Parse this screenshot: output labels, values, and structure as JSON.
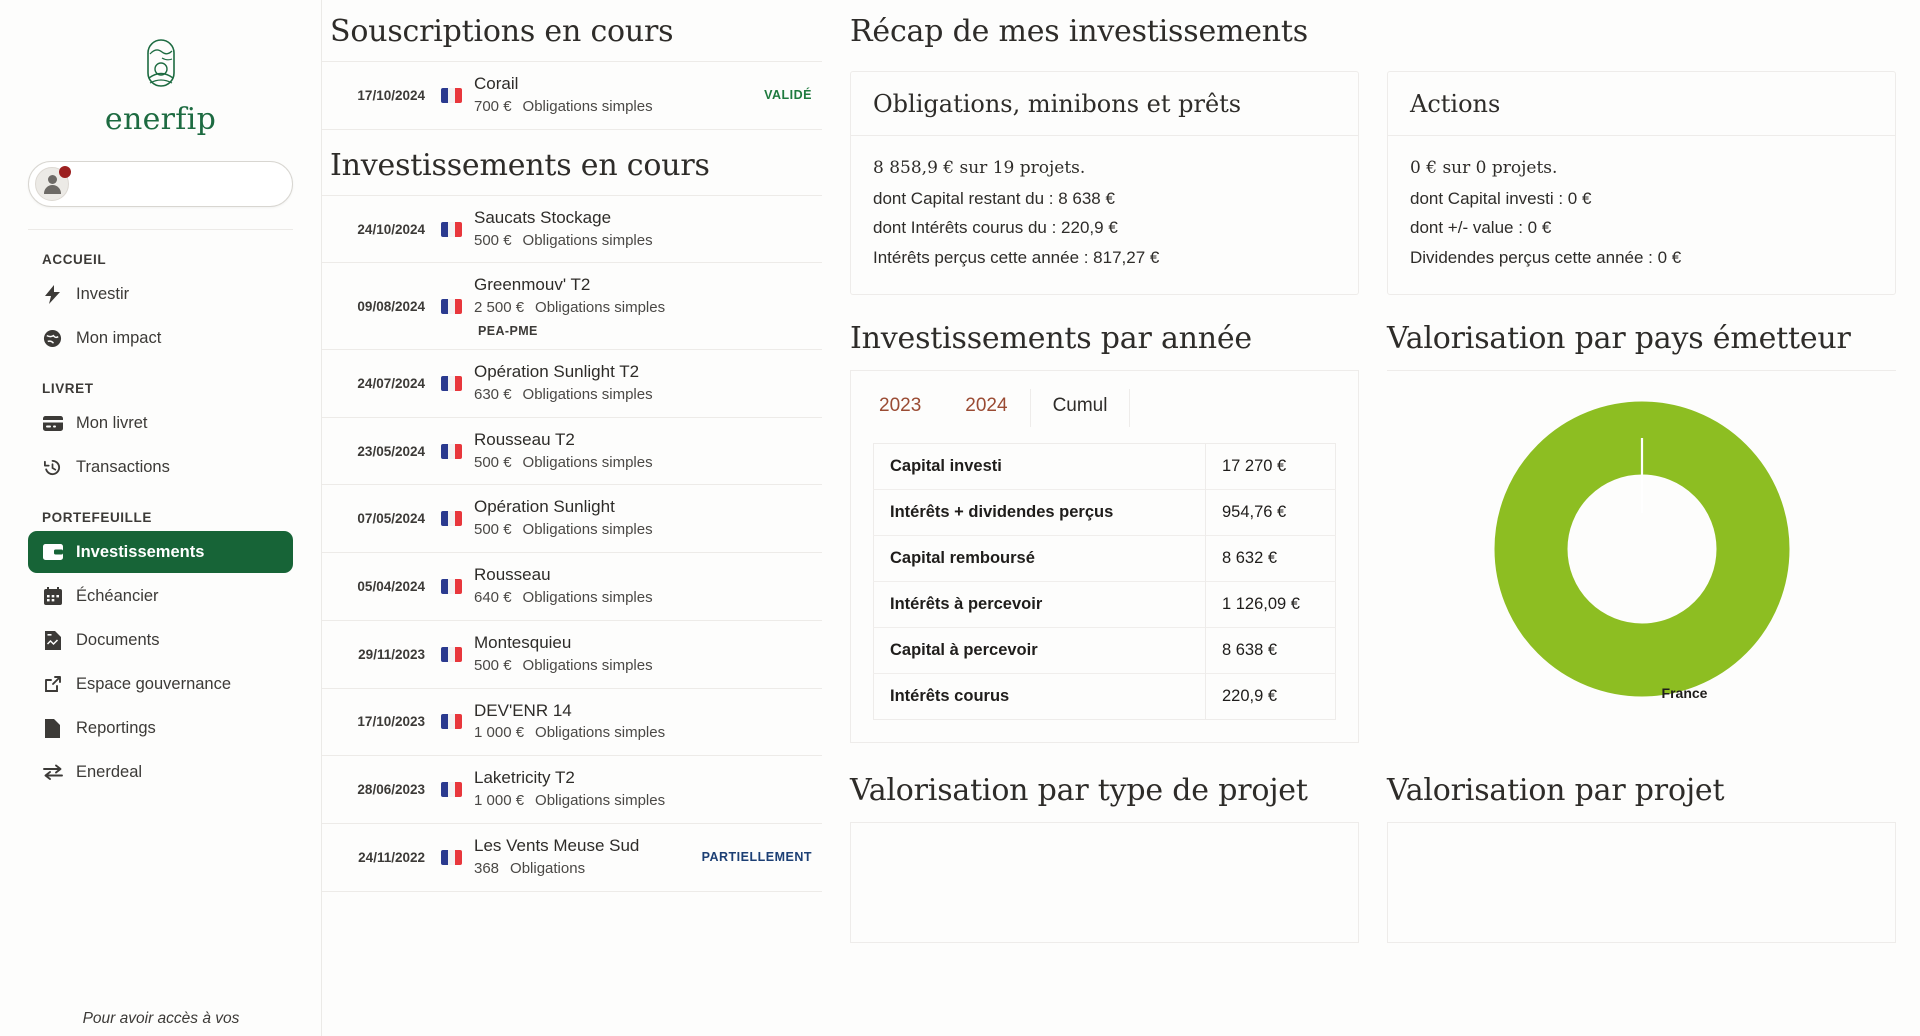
{
  "sidebar": {
    "brand": "enerfip",
    "sections": [
      {
        "label": "ACCUEIL",
        "items": [
          {
            "label": "Investir",
            "icon": "bolt-icon"
          },
          {
            "label": "Mon impact",
            "icon": "globe-icon"
          }
        ]
      },
      {
        "label": "LIVRET",
        "items": [
          {
            "label": "Mon livret",
            "icon": "card-icon"
          },
          {
            "label": "Transactions",
            "icon": "history-icon"
          }
        ]
      },
      {
        "label": "PORTEFEUILLE",
        "items": [
          {
            "label": "Investissements",
            "icon": "wallet-icon",
            "active": true
          },
          {
            "label": "Échéancier",
            "icon": "calendar-icon"
          },
          {
            "label": "Documents",
            "icon": "document-icon"
          },
          {
            "label": "Espace gouvernance",
            "icon": "external-link-icon"
          },
          {
            "label": "Reportings",
            "icon": "file-icon"
          },
          {
            "label": "Enerdeal",
            "icon": "exchange-icon"
          }
        ]
      }
    ],
    "footnote": "Pour avoir accès à vos"
  },
  "subscriptions": {
    "title": "Souscriptions en cours",
    "rows": [
      {
        "date": "17/10/2024",
        "flag": "fr-flag-icon",
        "name": "Corail",
        "amount": "700 €",
        "type": "Obligations simples",
        "status": "VALIDÉ",
        "status_kind": "valide"
      }
    ]
  },
  "investments": {
    "title": "Investissements en cours",
    "rows": [
      {
        "date": "24/10/2024",
        "flag": "fr-flag-icon",
        "name": "Saucats Stockage",
        "amount": "500 €",
        "type": "Obligations simples"
      },
      {
        "date": "09/08/2024",
        "flag": "fr-flag-icon",
        "name": "Greenmouv' T2",
        "amount": "2 500 €",
        "type": "Obligations simples",
        "tag": "PEA-PME"
      },
      {
        "date": "24/07/2024",
        "flag": "fr-flag-icon",
        "name": "Opération Sunlight T2",
        "amount": "630 €",
        "type": "Obligations simples"
      },
      {
        "date": "23/05/2024",
        "flag": "fr-flag-icon",
        "name": "Rousseau T2",
        "amount": "500 €",
        "type": "Obligations simples"
      },
      {
        "date": "07/05/2024",
        "flag": "fr-flag-icon",
        "name": "Opération Sunlight",
        "amount": "500 €",
        "type": "Obligations simples"
      },
      {
        "date": "05/04/2024",
        "flag": "fr-flag-icon",
        "name": "Rousseau",
        "amount": "640 €",
        "type": "Obligations simples"
      },
      {
        "date": "29/11/2023",
        "flag": "fr-flag-icon",
        "name": "Montesquieu",
        "amount": "500 €",
        "type": "Obligations simples"
      },
      {
        "date": "17/10/2023",
        "flag": "fr-flag-icon",
        "name": "DEV'ENR 14",
        "amount": "1 000 €",
        "type": "Obligations simples"
      },
      {
        "date": "28/06/2023",
        "flag": "fr-flag-icon",
        "name": "Laketricity T2",
        "amount": "1 000 €",
        "type": "Obligations simples"
      },
      {
        "date": "24/11/2022",
        "flag": "fr-flag-icon",
        "name": "Les Vents Meuse Sud",
        "amount": "368",
        "type": "Obligations",
        "status": "PARTIELLEMENT",
        "status_kind": "partiel"
      }
    ]
  },
  "recap": {
    "title": "Récap de mes investissements",
    "cards": [
      {
        "head": "Obligations, minibons et prêts",
        "lines": [
          "8 858,9 € sur 19 projets.",
          "dont Capital restant du : 8 638 €",
          "dont Intérêts courus du : 220,9 €",
          "Intérêts perçus cette année : 817,27 €"
        ]
      },
      {
        "head": "Actions",
        "lines": [
          "0 € sur 0 projets.",
          "dont Capital investi : 0 €",
          "dont +/- value : 0 €",
          "Dividendes perçus cette année : 0 €"
        ]
      }
    ]
  },
  "by_year": {
    "title": "Investissements par année",
    "tabs": [
      {
        "label": "2023",
        "active": false
      },
      {
        "label": "2024",
        "active": false
      },
      {
        "label": "Cumul",
        "active": true
      }
    ],
    "rows": [
      {
        "k": "Capital investi",
        "v": "17 270 €"
      },
      {
        "k": "Intérêts + dividendes perçus",
        "v": "954,76 €"
      },
      {
        "k": "Capital remboursé",
        "v": "8 632 €"
      },
      {
        "k": "Intérêts à percevoir",
        "v": "1 126,09 €"
      },
      {
        "k": "Capital à percevoir",
        "v": "8 638 €"
      },
      {
        "k": "Intérêts courus",
        "v": "220,9 €"
      }
    ]
  },
  "by_country": {
    "title": "Valorisation par pays émetteur"
  },
  "by_type": {
    "title": "Valorisation par type de projet"
  },
  "by_project": {
    "title": "Valorisation par projet"
  },
  "colors": {
    "brand_green": "#176437",
    "logo_green": "#1d6b41",
    "donut_green": "#8DBE22",
    "tab_link": "#9a4b33",
    "status_valide": "#1e7a3e",
    "status_partiel": "#1c3f74"
  },
  "chart_data": {
    "type": "pie",
    "title": "Valorisation par pays émetteur",
    "labels": [
      "France"
    ],
    "values": [
      100
    ],
    "colors": [
      "#8DBE22"
    ],
    "donut": true,
    "legend": "callout-label"
  }
}
